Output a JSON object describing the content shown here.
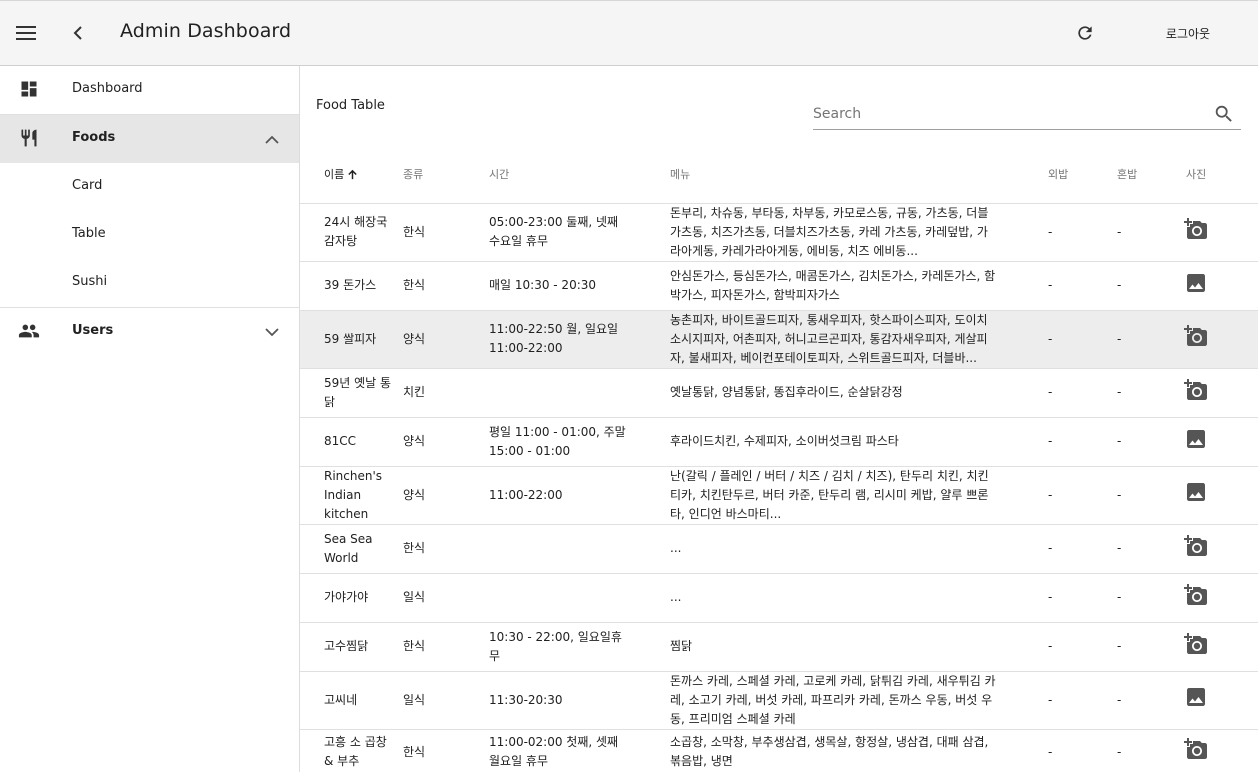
{
  "appbar": {
    "title": "Admin Dashboard",
    "logout_label": "로그아웃",
    "icons": {
      "menu": "menu-icon",
      "back": "chevron-left-icon",
      "refresh": "refresh-icon"
    }
  },
  "sidebar": {
    "items": [
      {
        "label": "Dashboard",
        "icon": "dashboard-icon"
      },
      {
        "label": "Foods",
        "icon": "restaurant-icon",
        "expanded": true
      },
      {
        "label": "Card"
      },
      {
        "label": "Table"
      },
      {
        "label": "Sushi"
      },
      {
        "label": "Users",
        "icon": "people-icon",
        "expanded": false
      }
    ]
  },
  "table": {
    "title": "Food Table",
    "search_placeholder": "Search",
    "columns": [
      "이름",
      "종류",
      "시간",
      "메뉴",
      "외밥",
      "혼밥",
      "사진"
    ],
    "sort_column": "이름",
    "rows": [
      {
        "name": "24시 해장국 감자탕",
        "type": "한식",
        "time": "05:00-23:00 둘째, 넷째 수요일 휴무",
        "menu": "돈부리, 차슈동, 부타동, 차부동, 카모로스동, 규동, 가츠동, 더블가츠동, 치즈가츠동, 더블치즈가츠동, 카레 가츠동, 카레덮밥, 가라아게동, 카레가라아게동, 에비동, 치즈 에비동...",
        "out": "-",
        "mix": "-",
        "photo": "add-photo"
      },
      {
        "name": "39 돈가스",
        "type": "한식",
        "time": "매일 10:30 - 20:30",
        "menu": "안심돈가스, 등심돈가스, 매콤돈가스, 김치돈가스, 카레돈가스, 함박가스, 피자돈가스, 함박피자가스",
        "out": "-",
        "mix": "-",
        "photo": "image"
      },
      {
        "name": "59 쌀피자",
        "type": "양식",
        "time": "11:00-22:50 월, 일요일 11:00-22:00",
        "menu": "농촌피자, 바이트골드피자, 통새우피자, 핫스파이스피자, 도이치소시지피자, 어촌피자, 허니고르곤피자, 통감자새우피자, 게살피자, 불새피자, 베이컨포테이토피자, 스위트골드피자, 더블바...",
        "out": "-",
        "mix": "-",
        "photo": "add-photo",
        "selected": true
      },
      {
        "name": "59년 옛날 통닭",
        "type": "치킨",
        "time": "",
        "menu": "옛날통닭, 양념통닭, 똥집후라이드, 순살닭강정",
        "out": "-",
        "mix": "-",
        "photo": "add-photo"
      },
      {
        "name": "81CC",
        "type": "양식",
        "time": "평일 11:00 - 01:00, 주말 15:00 - 01:00",
        "menu": "후라이드치킨, 수제피자, 소이버섯크림 파스타",
        "out": "-",
        "mix": "-",
        "photo": "image"
      },
      {
        "name": "Rinchen's Indian kitchen",
        "type": "양식",
        "time": "11:00-22:00",
        "menu": "난(갈릭 / 플레인 / 버터 / 치즈 / 김치 / 치즈), 탄두리 치킨, 치킨티카, 치킨탄두르, 버터 카준, 탄두리 램, 리시미 케밥, 얄루 쁘론타, 인디언 바스마티...",
        "out": "-",
        "mix": "-",
        "photo": "image"
      },
      {
        "name": "Sea Sea World",
        "type": "한식",
        "time": "",
        "menu": "...",
        "out": "-",
        "mix": "-",
        "photo": "add-photo"
      },
      {
        "name": "가야가야",
        "type": "일식",
        "time": "",
        "menu": "...",
        "out": "-",
        "mix": "-",
        "photo": "add-photo"
      },
      {
        "name": "고수찜닭",
        "type": "한식",
        "time": "10:30 - 22:00, 일요일휴무",
        "menu": "찜닭",
        "out": "-",
        "mix": "-",
        "photo": "add-photo"
      },
      {
        "name": "고씨네",
        "type": "일식",
        "time": "11:30-20:30",
        "menu": "돈까스 카레, 스페셜 카레, 고로케 카레, 닭튀김 카레, 새우튀김 카레, 소고기 카레, 버섯 카레, 파프리카 카레, 돈까스 우동, 버섯 우동, 프리미엄 스페셜 카레",
        "out": "-",
        "mix": "-",
        "photo": "image"
      },
      {
        "name": "고흥 소 곱창 & 부추",
        "type": "한식",
        "time": "11:00-02:00 첫째, 셋째 월요일 휴무",
        "menu": "소곱창, 소막창, 부추생삼겹, 생목살, 항정살, 냉삼겹, 대패 삼겹, 볶음밥, 냉면",
        "out": "-",
        "mix": "-",
        "photo": "add-photo"
      }
    ]
  }
}
